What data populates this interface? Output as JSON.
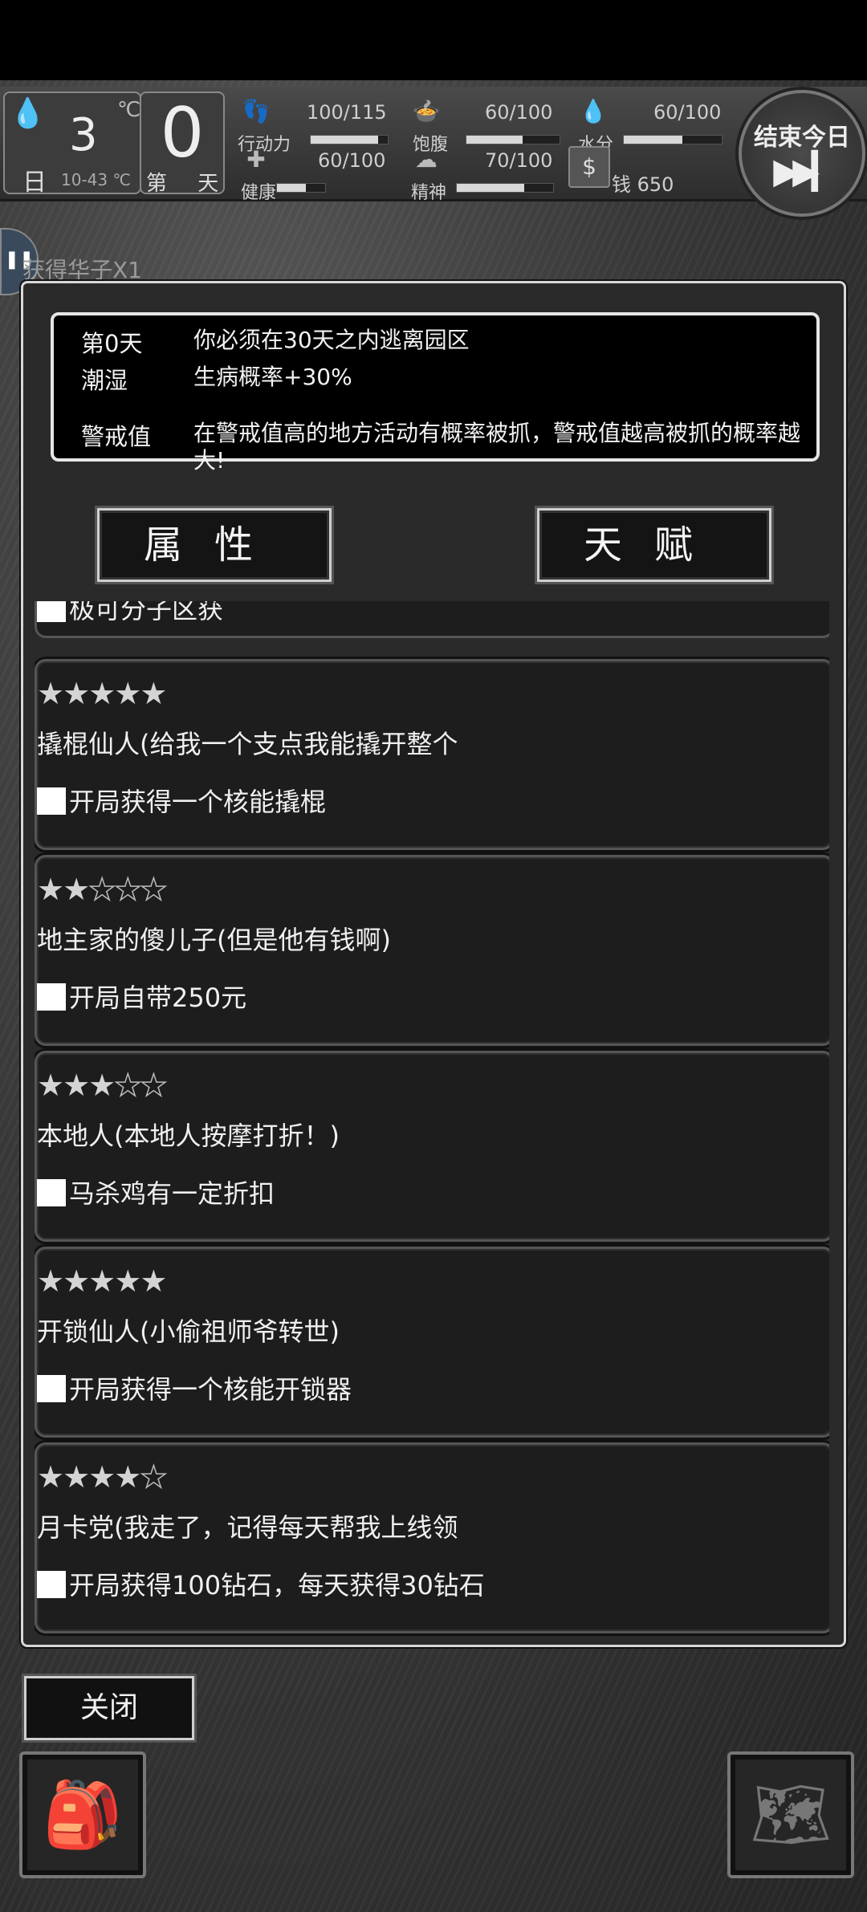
{
  "hud": {
    "weather": {
      "icon": "rain-drops-icon",
      "temp": "3",
      "unit": "℃",
      "day_char": "日",
      "range": "10-43 ℃"
    },
    "day": {
      "num": "0",
      "label": "第 天"
    },
    "stats": [
      {
        "name": "stat-action",
        "label": "行动力",
        "value": "100/115",
        "fraction": 0.87,
        "icon": "footprints-icon"
      },
      {
        "name": "stat-hunger",
        "label": "饱腹",
        "value": "60/100",
        "fraction": 0.6,
        "icon": "food-icon"
      },
      {
        "name": "stat-water",
        "label": "水分",
        "value": "60/100",
        "fraction": 0.6,
        "icon": "water-icon"
      },
      {
        "name": "stat-health",
        "label": "健康",
        "value": "60/100",
        "fraction": 0.6,
        "icon": "medkit-icon"
      },
      {
        "name": "stat-spirit",
        "label": "精神",
        "value": "70/100",
        "fraction": 0.7,
        "icon": "brain-icon"
      }
    ],
    "money": {
      "label": "钱 650",
      "icon": "money-icon"
    },
    "end_day": {
      "label": "结束今日",
      "icon": "fast-forward-icon"
    }
  },
  "toast": {
    "text": "获得华子X1"
  },
  "info": {
    "day_label": "第0天",
    "day_text": "你必须在30天之内逃离园区",
    "weather_label": "潮湿",
    "weather_text": "生病概率+30%",
    "alert_label": "警戒值",
    "alert_text": "在警戒值高的地方活动有概率被抓，警戒值越高被抓的概率越大!"
  },
  "tabs": {
    "attributes": "属性",
    "talents": "天赋"
  },
  "talents": [
    {
      "stars": 5,
      "title": "撬棍仙人(给我一个支点我能撬开整个",
      "effect": "开局获得一个核能撬棍"
    },
    {
      "stars": 2,
      "title": "地主家的傻儿子(但是他有钱啊)",
      "effect": "开局自带250元"
    },
    {
      "stars": 3,
      "title": "本地人(本地人按摩打折！)",
      "effect": "马杀鸡有一定折扣"
    },
    {
      "stars": 5,
      "title": "开锁仙人(小偷祖师爷转世)",
      "effect": "开局获得一个核能开锁器"
    },
    {
      "stars": 4,
      "title": "月卡党(我走了，记得每天帮我上线领",
      "effect": "开局获得100钻石，每天获得30钻石"
    }
  ],
  "partial_talent": {
    "effect": "极可分子区获"
  },
  "close_label": "关闭",
  "bottom": {
    "backpack_icon": "backpack-icon",
    "map_icon": "map-icon"
  },
  "colors": {
    "background": "#3a3a3a",
    "panel": "#000000",
    "border": "#e6e6e6"
  }
}
